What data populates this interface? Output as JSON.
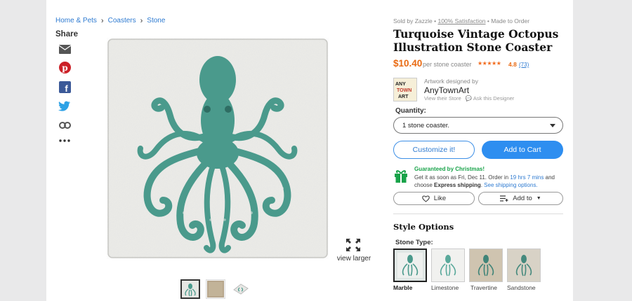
{
  "breadcrumb": [
    "Home & Pets",
    "Coasters",
    "Stone"
  ],
  "share": {
    "title": "Share",
    "icons": [
      "email-icon",
      "pinterest-icon",
      "facebook-icon",
      "twitter-icon",
      "link-icon",
      "more-icon"
    ]
  },
  "image": {
    "view_larger": "view larger"
  },
  "meta": {
    "sold_by": "Sold by Zazzle",
    "satisfaction": "100% Satisfaction",
    "made_to_order": "Made to Order"
  },
  "product": {
    "title": "Turquoise Vintage Octopus Illustration Stone Coaster",
    "price": "$10.40",
    "per": "per stone coaster",
    "rating": "4.8",
    "reviews": "(73)",
    "stars": 5
  },
  "designer": {
    "designed_by": "Artwork designed by",
    "name": "AnyTownArt",
    "view_store": "View their Store",
    "ask": "Ask this Designer"
  },
  "quantity": {
    "label": "Quantity:",
    "value": "1 stone coaster."
  },
  "buttons": {
    "customize": "Customize it!",
    "cart": "Add to Cart",
    "like": "Like",
    "add_to": "Add to"
  },
  "delivery": {
    "guarantee": "Guaranteed by Christmas!",
    "line1": "Get it as soon as Fri, Dec 11. Order in",
    "time": "19 hrs 7 mins",
    "and": "and",
    "choose": "choose",
    "express": "Express shipping",
    "see": "See shipping options."
  },
  "style_options": {
    "title": "Style Options",
    "stone_type_label": "Stone Type:",
    "options": [
      "Marble",
      "Limestone",
      "Travertine",
      "Sandstone"
    ],
    "selected": "Marble"
  },
  "colors": {
    "accent": "#2e8ef0",
    "price": "#e96a12",
    "octopus": "#4a9a8c",
    "green": "#19a34a"
  }
}
